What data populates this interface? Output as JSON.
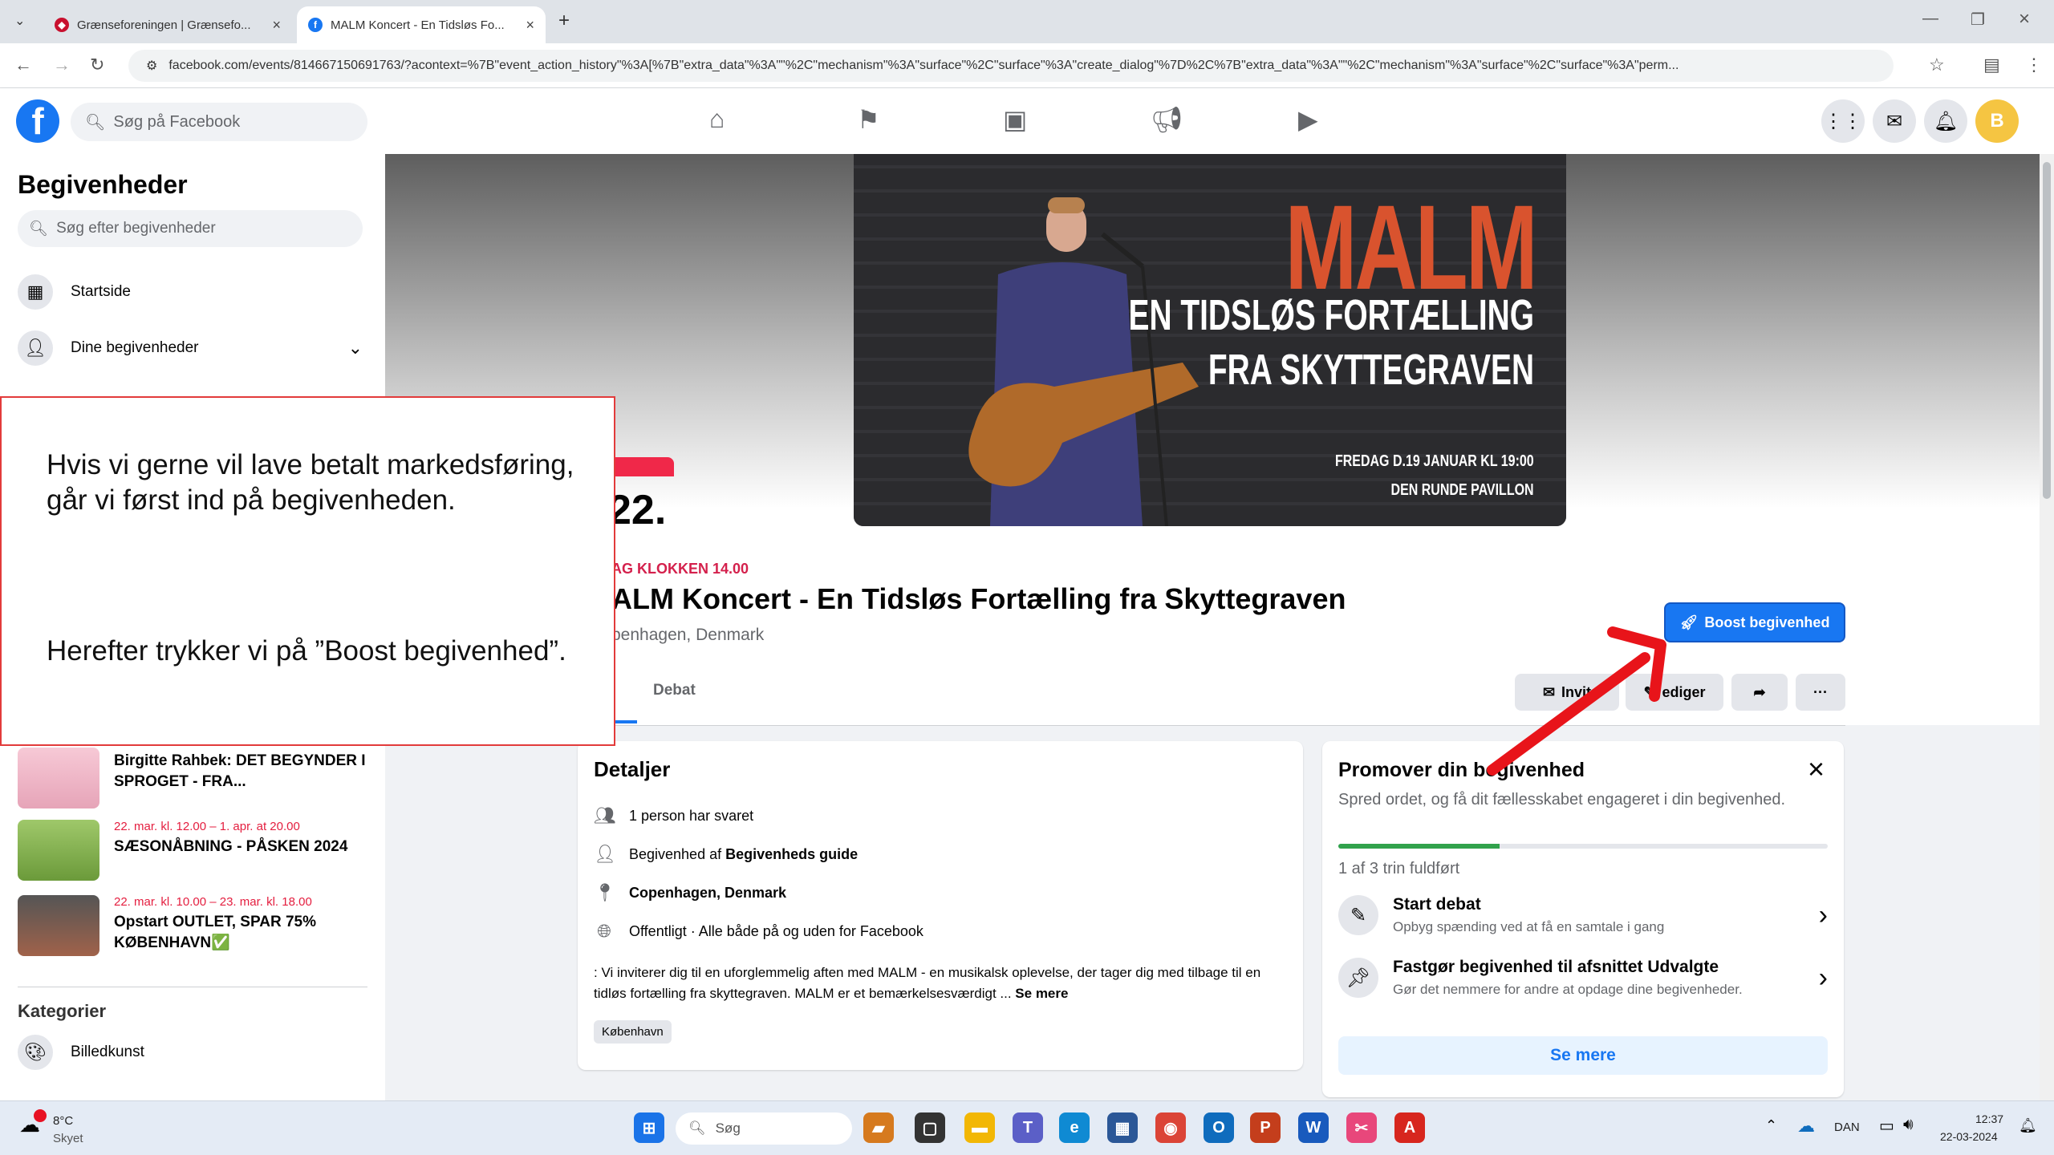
{
  "browser": {
    "tabs": [
      {
        "title": "Grænseforeningen | Grænsefo...",
        "active": false
      },
      {
        "title": "MALM Koncert - En Tidsløs Fo...",
        "active": true
      }
    ],
    "url": "facebook.com/events/814667150691763/?acontext=%7B\"event_action_history\"%3A[%7B\"extra_data\"%3A\"\"%2C\"mechanism\"%3A\"surface\"%2C\"surface\"%3A\"create_dialog\"%7D%2C%7B\"extra_data\"%3A\"\"%2C\"mechanism\"%3A\"surface\"%2C\"surface\"%3A\"perm..."
  },
  "fb": {
    "search_placeholder": "Søg på Facebook",
    "avatar_letter": "B"
  },
  "sidebar": {
    "title": "Begivenheder",
    "search_placeholder": "Søg efter begivenheder",
    "items": [
      {
        "label": "Startside"
      },
      {
        "label": "Dine begivenheder"
      }
    ],
    "events": [
      {
        "date": "",
        "name": "Birgitte Rahbek: DET BEGYNDER I SPROGET - FRA..."
      },
      {
        "date": "22. mar. kl. 12.00 – 1. apr. at 20.00",
        "name": "SÆSONÅBNING - PÅSKEN 2024"
      },
      {
        "date": "22. mar. kl. 10.00 – 23. mar. kl. 18.00",
        "name": "Opstart OUTLET, SPAR 75% KØBENHAVN✅"
      }
    ],
    "categories_title": "Kategorier",
    "categories": [
      {
        "label": "Billedkunst"
      }
    ]
  },
  "event": {
    "cover": {
      "title": "MALM",
      "line1": "EN TIDSLØS FORTÆLLING",
      "line2": "FRA SKYTTEGRAVEN",
      "date_line": "FREDAG D.19 JANUAR KL 19:00",
      "venue_line": "DEN RUNDE PAVILLON"
    },
    "day": "22.",
    "time": "AG KLOKKEN 14.00",
    "title": "ALM Koncert - En Tidsløs Fortælling fra Skyttegraven",
    "location": "penhagen, Denmark",
    "boost_label": "Boost begivenhed",
    "tab_debat": "Debat",
    "invite_label": "Invit",
    "edit_label": "ediger"
  },
  "details": {
    "title": "Detaljer",
    "rows": [
      {
        "text": "1 person har svaret"
      },
      {
        "prefix": "Begivenhed af ",
        "bold": "Begivenheds guide"
      },
      {
        "bold": "Copenhagen, Denmark"
      },
      {
        "text": "Offentligt · Alle både på og uden for Facebook"
      }
    ],
    "description": ": Vi inviterer dig til en uforglemmelig aften med MALM - en musikalsk oplevelse, der tager dig med tilbage til en tidløs fortælling fra skyttegraven. MALM er et bemærkelsesværdigt ...",
    "see_more": "Se mere",
    "chip": "København"
  },
  "promo": {
    "title": "Promover din begivenhed",
    "subtitle": "Spred ordet, og få dit fællesskabet engageret i din begivenhed.",
    "progress": 0.33,
    "steps": "1 af 3 trin fuldført",
    "rows": [
      {
        "title": "Start debat",
        "desc": "Opbyg spænding ved at få en samtale i gang"
      },
      {
        "title": "Fastgør begivenhed til afsnittet Udvalgte",
        "desc": "Gør det nemmere for andre at opdage dine begivenheder."
      }
    ],
    "more": "Se mere"
  },
  "annotation": {
    "p1": "Hvis vi gerne vil lave betalt markedsføring, går vi først ind på begivenheden.",
    "p2": "Herefter trykker vi på ”Boost begivenhed”."
  },
  "taskbar": {
    "weather_temp": "8°C",
    "weather_desc": "Skyet",
    "search": "Søg",
    "lang": "DAN",
    "time": "12:37",
    "date": "22-03-2024"
  },
  "colors": {
    "fb_blue": "#1877f2",
    "annotation_red": "#e23b3b",
    "arrow_red": "#e8141a",
    "date_red": "#d4204c"
  }
}
